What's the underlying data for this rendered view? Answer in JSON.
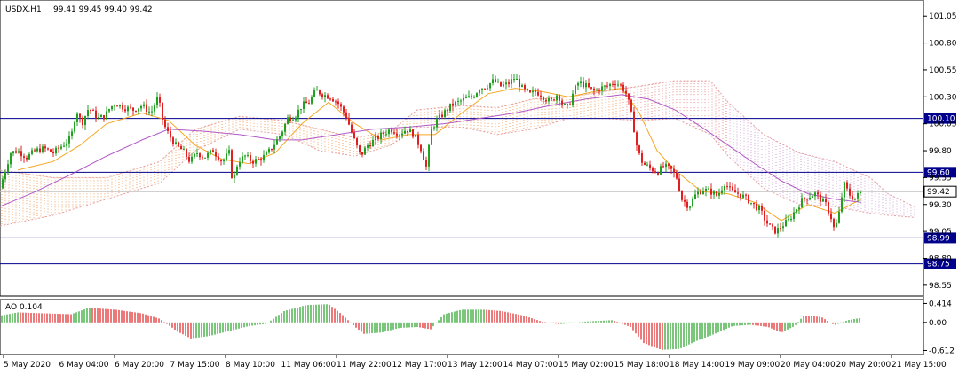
{
  "chart_data": {
    "type": "candlestick",
    "header": {
      "symbol": "USDX,H1",
      "ohlc": "99.41 99.45 99.40 99.42"
    },
    "y_axis": {
      "ylim": [
        98.45,
        101.2
      ],
      "ticks": [
        "101.05",
        "100.80",
        "100.55",
        "100.30",
        "100.05",
        "99.80",
        "99.55",
        "99.30",
        "99.05",
        "98.80",
        "98.55"
      ]
    },
    "x_axis": {
      "labels": [
        "5 May 2020",
        "6 May 04:00",
        "6 May 20:00",
        "7 May 15:00",
        "8 May 10:00",
        "11 May 06:00",
        "11 May 22:00",
        "12 May 17:00",
        "13 May 12:00",
        "14 May 07:00",
        "15 May 02:00",
        "15 May 18:00",
        "18 May 14:00",
        "19 May 09:00",
        "20 May 04:00",
        "20 May 20:00",
        "21 May 15:00"
      ]
    },
    "horizontal_levels": [
      {
        "label": "100.10",
        "value": 100.1,
        "color": "#00008b"
      },
      {
        "label": "99.60",
        "value": 99.6,
        "color": "#00008b"
      },
      {
        "label": "98.99",
        "value": 98.99,
        "color": "#00008b"
      },
      {
        "label": "98.75",
        "value": 98.75,
        "color": "#00008b"
      }
    ],
    "current_price": {
      "label": "99.42",
      "value": 99.42
    },
    "close_path": [
      [
        0,
        99.45
      ],
      [
        6,
        99.62
      ],
      [
        12,
        99.78
      ],
      [
        20,
        99.8
      ],
      [
        30,
        99.74
      ],
      [
        40,
        99.8
      ],
      [
        50,
        99.82
      ],
      [
        60,
        99.78
      ],
      [
        72,
        99.86
      ],
      [
        80,
        99.92
      ],
      [
        86,
        100.18
      ],
      [
        92,
        100.05
      ],
      [
        100,
        100.2
      ],
      [
        110,
        100.1
      ],
      [
        118,
        100.12
      ],
      [
        124,
        100.2
      ],
      [
        130,
        100.24
      ],
      [
        140,
        100.2
      ],
      [
        150,
        100.18
      ],
      [
        160,
        100.22
      ],
      [
        170,
        100.15
      ],
      [
        178,
        100.3
      ],
      [
        184,
        100.05
      ],
      [
        190,
        99.95
      ],
      [
        198,
        99.85
      ],
      [
        206,
        99.8
      ],
      [
        214,
        99.7
      ],
      [
        222,
        99.78
      ],
      [
        230,
        99.74
      ],
      [
        240,
        99.8
      ],
      [
        250,
        99.7
      ],
      [
        258,
        99.78
      ],
      [
        262,
        99.5
      ],
      [
        268,
        99.7
      ],
      [
        276,
        99.75
      ],
      [
        284,
        99.7
      ],
      [
        292,
        99.72
      ],
      [
        300,
        99.76
      ],
      [
        308,
        99.85
      ],
      [
        316,
        99.95
      ],
      [
        324,
        100.1
      ],
      [
        332,
        100.12
      ],
      [
        340,
        100.22
      ],
      [
        348,
        100.25
      ],
      [
        356,
        100.36
      ],
      [
        364,
        100.32
      ],
      [
        372,
        100.3
      ],
      [
        380,
        100.25
      ],
      [
        390,
        100.12
      ],
      [
        398,
        99.92
      ],
      [
        406,
        99.75
      ],
      [
        414,
        99.85
      ],
      [
        422,
        99.9
      ],
      [
        430,
        99.95
      ],
      [
        440,
        100.0
      ],
      [
        450,
        99.96
      ],
      [
        458,
        100.0
      ],
      [
        466,
        99.95
      ],
      [
        474,
        99.82
      ],
      [
        480,
        99.65
      ],
      [
        486,
        100.0
      ],
      [
        492,
        100.08
      ],
      [
        500,
        100.15
      ],
      [
        508,
        100.22
      ],
      [
        516,
        100.25
      ],
      [
        524,
        100.28
      ],
      [
        532,
        100.3
      ],
      [
        540,
        100.38
      ],
      [
        548,
        100.4
      ],
      [
        556,
        100.45
      ],
      [
        564,
        100.4
      ],
      [
        572,
        100.42
      ],
      [
        580,
        100.48
      ],
      [
        588,
        100.38
      ],
      [
        596,
        100.32
      ],
      [
        604,
        100.35
      ],
      [
        612,
        100.3
      ],
      [
        620,
        100.25
      ],
      [
        628,
        100.33
      ],
      [
        634,
        100.22
      ],
      [
        640,
        100.2
      ],
      [
        646,
        100.35
      ],
      [
        652,
        100.44
      ],
      [
        660,
        100.4
      ],
      [
        668,
        100.35
      ],
      [
        676,
        100.38
      ],
      [
        684,
        100.4
      ],
      [
        692,
        100.44
      ],
      [
        700,
        100.4
      ],
      [
        706,
        100.32
      ],
      [
        712,
        100.1
      ],
      [
        718,
        99.8
      ],
      [
        724,
        99.68
      ],
      [
        732,
        99.64
      ],
      [
        740,
        99.6
      ],
      [
        748,
        99.66
      ],
      [
        756,
        99.62
      ],
      [
        762,
        99.55
      ],
      [
        768,
        99.35
      ],
      [
        776,
        99.28
      ],
      [
        784,
        99.4
      ],
      [
        792,
        99.44
      ],
      [
        800,
        99.42
      ],
      [
        808,
        99.38
      ],
      [
        816,
        99.5
      ],
      [
        824,
        99.42
      ],
      [
        832,
        99.4
      ],
      [
        840,
        99.36
      ],
      [
        848,
        99.3
      ],
      [
        856,
        99.25
      ],
      [
        862,
        99.15
      ],
      [
        868,
        99.08
      ],
      [
        874,
        99.05
      ],
      [
        880,
        99.1
      ],
      [
        888,
        99.15
      ],
      [
        896,
        99.25
      ],
      [
        904,
        99.35
      ],
      [
        912,
        99.38
      ],
      [
        918,
        99.4
      ],
      [
        924,
        99.35
      ],
      [
        930,
        99.3
      ],
      [
        936,
        99.18
      ],
      [
        940,
        99.05
      ],
      [
        946,
        99.25
      ],
      [
        950,
        99.5
      ],
      [
        956,
        99.4
      ],
      [
        962,
        99.35
      ],
      [
        970,
        99.42
      ]
    ],
    "indicators": {
      "fast_ma": {
        "color": "#f5a623",
        "points": [
          [
            20,
            99.62
          ],
          [
            60,
            99.7
          ],
          [
            90,
            99.85
          ],
          [
            120,
            100.05
          ],
          [
            160,
            100.15
          ],
          [
            190,
            100.08
          ],
          [
            220,
            99.85
          ],
          [
            250,
            99.72
          ],
          [
            280,
            99.68
          ],
          [
            310,
            99.78
          ],
          [
            340,
            100.05
          ],
          [
            370,
            100.25
          ],
          [
            400,
            100.05
          ],
          [
            430,
            99.9
          ],
          [
            460,
            99.95
          ],
          [
            490,
            99.95
          ],
          [
            520,
            100.15
          ],
          [
            550,
            100.33
          ],
          [
            580,
            100.38
          ],
          [
            610,
            100.35
          ],
          [
            640,
            100.3
          ],
          [
            670,
            100.35
          ],
          [
            700,
            100.38
          ],
          [
            720,
            100.15
          ],
          [
            740,
            99.8
          ],
          [
            760,
            99.62
          ],
          [
            790,
            99.42
          ],
          [
            820,
            99.4
          ],
          [
            850,
            99.32
          ],
          [
            880,
            99.15
          ],
          [
            910,
            99.3
          ],
          [
            940,
            99.22
          ],
          [
            970,
            99.35
          ]
        ]
      },
      "slow_ma": {
        "color": "#b25ac7",
        "points": [
          [
            0,
            99.28
          ],
          [
            40,
            99.42
          ],
          [
            80,
            99.58
          ],
          [
            120,
            99.75
          ],
          [
            160,
            99.9
          ],
          [
            190,
            100.0
          ],
          [
            230,
            99.98
          ],
          [
            270,
            99.95
          ],
          [
            310,
            99.9
          ],
          [
            340,
            99.9
          ],
          [
            380,
            99.95
          ],
          [
            420,
            100.0
          ],
          [
            460,
            100.02
          ],
          [
            500,
            100.05
          ],
          [
            540,
            100.1
          ],
          [
            580,
            100.15
          ],
          [
            620,
            100.22
          ],
          [
            660,
            100.28
          ],
          [
            700,
            100.32
          ],
          [
            730,
            100.28
          ],
          [
            760,
            100.18
          ],
          [
            790,
            100.02
          ],
          [
            820,
            99.85
          ],
          [
            850,
            99.68
          ],
          [
            880,
            99.52
          ],
          [
            910,
            99.4
          ],
          [
            940,
            99.35
          ],
          [
            970,
            99.32
          ]
        ]
      },
      "cloud_upper": [
        [
          0,
          99.62
        ],
        [
          60,
          99.55
        ],
        [
          120,
          99.55
        ],
        [
          180,
          99.7
        ],
        [
          220,
          100.0
        ],
        [
          270,
          100.12
        ],
        [
          320,
          100.08
        ],
        [
          360,
          100.0
        ],
        [
          400,
          99.92
        ],
        [
          440,
          99.98
        ],
        [
          470,
          100.18
        ],
        [
          520,
          100.22
        ],
        [
          560,
          100.2
        ],
        [
          600,
          100.28
        ],
        [
          640,
          100.3
        ],
        [
          680,
          100.35
        ],
        [
          720,
          100.4
        ],
        [
          760,
          100.45
        ],
        [
          800,
          100.45
        ],
        [
          820,
          100.25
        ],
        [
          860,
          99.95
        ],
        [
          900,
          99.78
        ],
        [
          940,
          99.7
        ],
        [
          980,
          99.55
        ],
        [
          1000,
          99.4
        ],
        [
          1030,
          99.28
        ]
      ],
      "cloud_lower": [
        [
          0,
          99.1
        ],
        [
          60,
          99.2
        ],
        [
          120,
          99.35
        ],
        [
          180,
          99.5
        ],
        [
          220,
          99.8
        ],
        [
          270,
          100.0
        ],
        [
          320,
          99.95
        ],
        [
          360,
          99.8
        ],
        [
          400,
          99.75
        ],
        [
          440,
          99.85
        ],
        [
          470,
          100.02
        ],
        [
          520,
          100.02
        ],
        [
          560,
          99.95
        ],
        [
          600,
          100.0
        ],
        [
          640,
          100.1
        ],
        [
          680,
          100.1
        ],
        [
          720,
          100.08
        ],
        [
          760,
          100.1
        ],
        [
          800,
          99.95
        ],
        [
          820,
          99.75
        ],
        [
          860,
          99.45
        ],
        [
          900,
          99.3
        ],
        [
          940,
          99.28
        ],
        [
          980,
          99.22
        ],
        [
          1000,
          99.2
        ],
        [
          1030,
          99.18
        ]
      ]
    },
    "oscillator": {
      "label": "AO 0.104",
      "ylim": [
        -0.7,
        0.5
      ],
      "ticks": [
        "0.414",
        "0.00",
        "-0.612"
      ],
      "path": [
        [
          0,
          0.15
        ],
        [
          20,
          0.22
        ],
        [
          50,
          0.2
        ],
        [
          80,
          0.18
        ],
        [
          100,
          0.32
        ],
        [
          130,
          0.28
        ],
        [
          160,
          0.2
        ],
        [
          180,
          0.08
        ],
        [
          200,
          -0.2
        ],
        [
          215,
          -0.35
        ],
        [
          235,
          -0.3
        ],
        [
          260,
          -0.18
        ],
        [
          280,
          -0.08
        ],
        [
          300,
          -0.03
        ],
        [
          320,
          0.25
        ],
        [
          345,
          0.38
        ],
        [
          370,
          0.4
        ],
        [
          385,
          0.18
        ],
        [
          400,
          -0.1
        ],
        [
          410,
          -0.25
        ],
        [
          430,
          -0.22
        ],
        [
          450,
          -0.12
        ],
        [
          470,
          -0.1
        ],
        [
          485,
          -0.15
        ],
        [
          500,
          0.18
        ],
        [
          520,
          0.28
        ],
        [
          545,
          0.28
        ],
        [
          565,
          0.25
        ],
        [
          590,
          0.15
        ],
        [
          610,
          0.02
        ],
        [
          630,
          -0.04
        ],
        [
          660,
          0.02
        ],
        [
          690,
          0.05
        ],
        [
          710,
          -0.1
        ],
        [
          725,
          -0.45
        ],
        [
          745,
          -0.6
        ],
        [
          765,
          -0.58
        ],
        [
          785,
          -0.4
        ],
        [
          805,
          -0.25
        ],
        [
          825,
          -0.08
        ],
        [
          845,
          -0.05
        ],
        [
          865,
          -0.1
        ],
        [
          880,
          -0.22
        ],
        [
          895,
          -0.08
        ],
        [
          905,
          0.15
        ],
        [
          925,
          0.12
        ],
        [
          940,
          -0.06
        ],
        [
          955,
          0.05
        ],
        [
          970,
          0.1
        ]
      ]
    }
  }
}
